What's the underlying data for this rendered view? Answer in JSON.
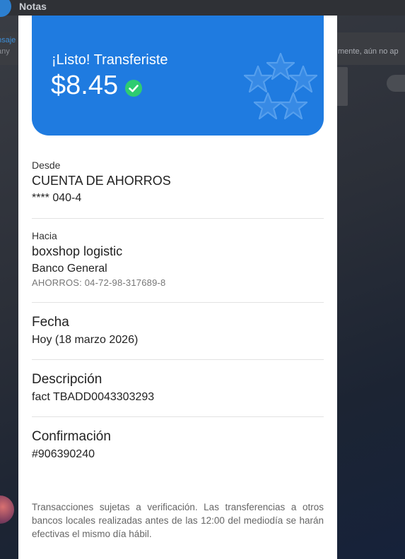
{
  "background": {
    "app_title": "Notas",
    "message_label": "nsaje",
    "message_preview": "any",
    "message_right": "mente, aún no ap"
  },
  "hero": {
    "title": "¡Listo! Transferiste",
    "amount": "$8.45",
    "accent_color": "#1f7be0",
    "status_color": "#2ecc71"
  },
  "from": {
    "label": "Desde",
    "account_type": "CUENTA DE AHORROS",
    "account_number": "**** 040-4"
  },
  "to": {
    "label": "Hacia",
    "name": "boxshop logistic",
    "bank": "Banco General",
    "account": "AHORROS: 04-72-98-317689-8"
  },
  "date": {
    "label": "Fecha",
    "value": "Hoy (18 marzo 2026)"
  },
  "description": {
    "label": "Descripción",
    "value": "fact TBADD0043303293"
  },
  "confirmation": {
    "label": "Confirmación",
    "value": "#906390240"
  },
  "disclaimer": "Transacciones sujetas a verificación. Las transferencias a otros bancos locales realizadas antes de las 12:00 del mediodía se harán efectivas el mismo día hábil."
}
